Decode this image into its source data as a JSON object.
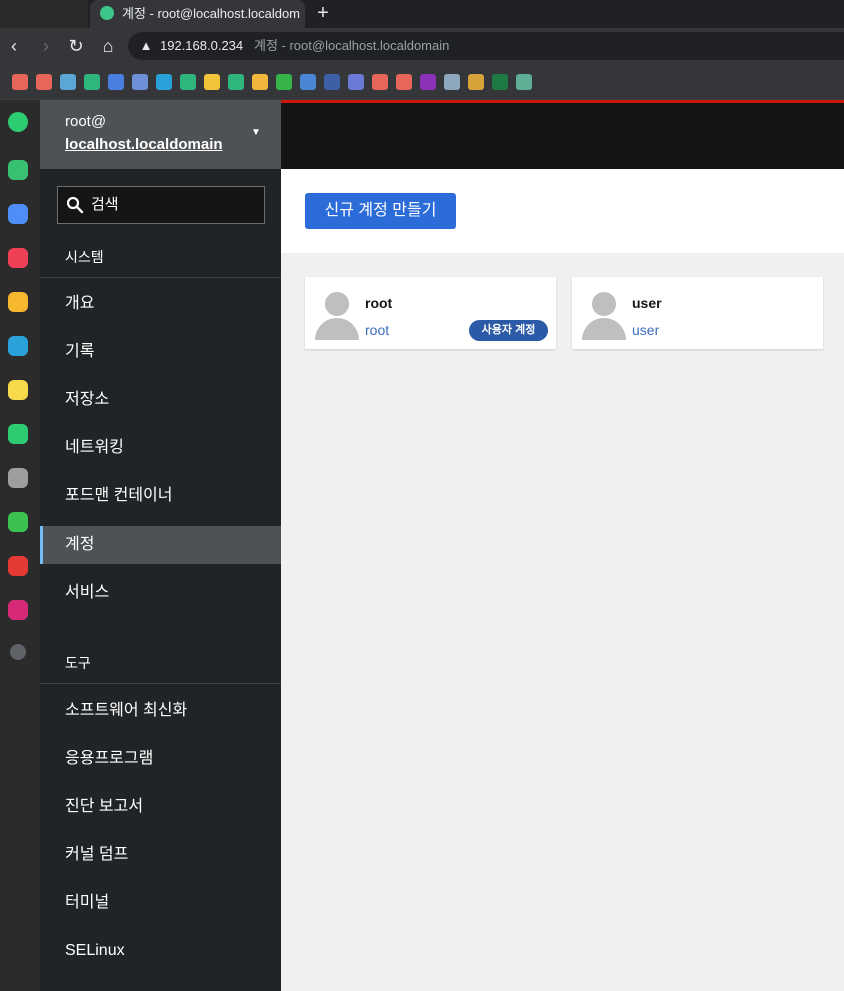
{
  "browser": {
    "tab_title": "계정 - root@localhost.localdom",
    "new_tab": "+",
    "url_host": "192.168.0.234",
    "url_rest": "계정 - root@localhost.localdomain",
    "bookmarks": [
      {
        "icon": "folder-icon",
        "color": "#e8655a"
      },
      {
        "icon": "folder-icon",
        "color": "#e8655a"
      },
      {
        "icon": "bird-icon",
        "color": "#5aa7d6"
      },
      {
        "icon": "n-icon",
        "color": "#2eb67d",
        "text": "N"
      },
      {
        "icon": "calendar-icon",
        "color": "#4a7ee0",
        "text": "23"
      },
      {
        "icon": "translate-icon",
        "color": "#6d8fd8",
        "text": "G"
      },
      {
        "icon": "edge-icon",
        "color": "#2aa1d9"
      },
      {
        "icon": "n-icon",
        "color": "#2eb67d",
        "text": "N"
      },
      {
        "icon": "map-pin-icon",
        "color": "#f3c33a"
      },
      {
        "icon": "map-icon",
        "color": "#2eb67d"
      },
      {
        "icon": "folder-icon",
        "color": "#f2b63d"
      },
      {
        "icon": "folder-icon",
        "color": "#36b34a"
      },
      {
        "icon": "folder-icon",
        "color": "#4a86d4"
      },
      {
        "icon": "folder-icon",
        "color": "#3d5fa5"
      },
      {
        "icon": "folder-icon",
        "color": "#6d79d6"
      },
      {
        "icon": "folder-icon",
        "color": "#e8655a"
      },
      {
        "icon": "folder-icon",
        "color": "#e8655a"
      },
      {
        "icon": "onenote-icon",
        "color": "#8c32b8",
        "text": "N"
      },
      {
        "icon": "wordpress-icon",
        "color": "#8fa7bd",
        "text": "W"
      },
      {
        "icon": "grid-icon",
        "color": "#d8a23b"
      },
      {
        "icon": "excel-icon",
        "color": "#1d7a45",
        "text": "X"
      },
      {
        "icon": "openai-icon",
        "color": "#5fae96"
      }
    ]
  },
  "rail": [
    {
      "icon": "circle-icon",
      "color": "#2ecc71"
    },
    {
      "icon": "bell-icon",
      "color": "#38c172"
    },
    {
      "icon": "briefcase-icon",
      "color": "#4f8ef7"
    },
    {
      "icon": "pocket-icon",
      "color": "#ef4056"
    },
    {
      "icon": "star-icon",
      "color": "#f5b82e"
    },
    {
      "icon": "edge-icon",
      "color": "#2aa1d9"
    },
    {
      "icon": "note-icon",
      "color": "#f7d94c"
    },
    {
      "icon": "play-icon",
      "color": "#2ecc71"
    },
    {
      "icon": "face-icon",
      "color": "#9e9e9e"
    },
    {
      "icon": "webtoon-icon",
      "color": "#3bc150",
      "text": "W"
    },
    {
      "icon": "now-icon",
      "color": "#e53935",
      "text": "NOW"
    },
    {
      "icon": "instagram-icon",
      "color": "#d62976"
    },
    {
      "icon": "add-icon",
      "color": "#5f6368",
      "text": "+"
    },
    {
      "icon": "external-link-icon",
      "color": "#2b2b2b",
      "text": "↗"
    }
  ],
  "sidebar": {
    "host_user": "root@",
    "host_name": "localhost.localdomain",
    "search_placeholder": "검색",
    "section_system": "시스템",
    "system_items": [
      "개요",
      "기록",
      "저장소",
      "네트워킹",
      "포드맨 컨테이너",
      "계정",
      "서비스"
    ],
    "active_item": "계정",
    "section_tools": "도구",
    "tool_items": [
      "소프트웨어 최신화",
      "응용프로그램",
      "진단 보고서",
      "커널 덤프",
      "터미널",
      "SELinux"
    ]
  },
  "main": {
    "create_button": "신규 계정 만들기",
    "accounts": [
      {
        "name": "root",
        "login": "root",
        "badge": "사용자 계정"
      },
      {
        "name": "user",
        "login": "user",
        "badge": ""
      }
    ]
  },
  "colors": {
    "accent": "#2b6cd9",
    "badge": "#2b5aa8",
    "sidebar_bg": "#212427",
    "active_bar": "#73bcf7",
    "red_line": "#c9190b"
  }
}
